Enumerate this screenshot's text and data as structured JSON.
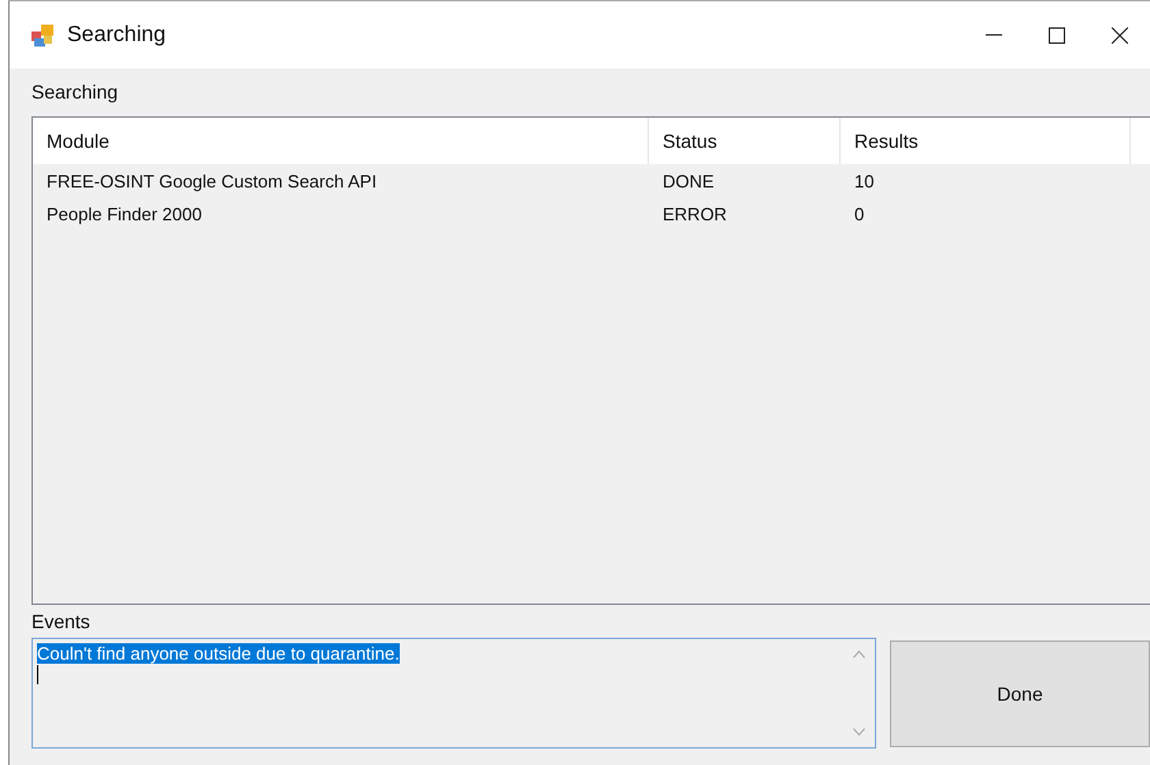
{
  "window": {
    "title": "Searching"
  },
  "results": {
    "label": "Searching",
    "columns": [
      "Module",
      "Status",
      "Results"
    ],
    "rows": [
      {
        "cells": [
          "FREE-OSINT Google Custom Search API",
          "DONE",
          "10"
        ]
      },
      {
        "cells": [
          "People Finder 2000",
          "ERROR",
          "0"
        ]
      }
    ]
  },
  "events": {
    "label": "Events",
    "value": "Couln't find anyone outside due to quarantine.",
    "selected": true
  },
  "buttons": [
    "Done"
  ]
}
